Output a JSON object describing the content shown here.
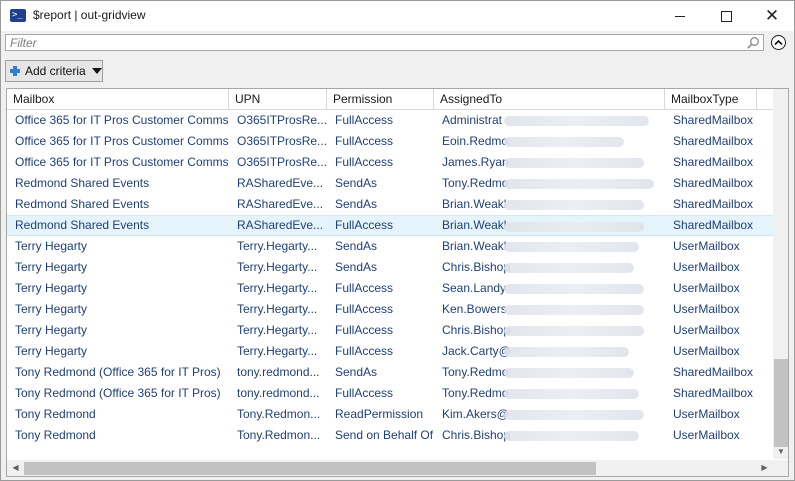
{
  "window": {
    "title": "$report | out-gridview",
    "app_icon": "powershell-icon",
    "controls": [
      "minimize-icon",
      "maximize-icon",
      "close-icon"
    ]
  },
  "filter": {
    "placeholder": "Filter",
    "value": "",
    "search_icon": "search-icon",
    "collapse_icon": "chevron-up-circle-icon"
  },
  "add_criteria": {
    "label": "Add criteria",
    "icon": "plus-icon",
    "dropdown_icon": "dropdown-arrow-icon"
  },
  "grid": {
    "columns": [
      "Mailbox",
      "UPN",
      "Permission",
      "AssignedTo",
      "MailboxType"
    ],
    "selected_row_index": 5,
    "rows": [
      {
        "mailbox": "Office 365 for IT Pros Customer Comms",
        "upn": "O365ITProsRe...",
        "permission": "FullAccess",
        "assigned_to": "Administrat",
        "type": "SharedMailbox"
      },
      {
        "mailbox": "Office 365 for IT Pros Customer Comms",
        "upn": "O365ITProsRe...",
        "permission": "FullAccess",
        "assigned_to": "Eoin.Redmo",
        "type": "SharedMailbox"
      },
      {
        "mailbox": "Office 365 for IT Pros Customer Comms",
        "upn": "O365ITProsRe...",
        "permission": "FullAccess",
        "assigned_to": "James.Ryan",
        "type": "SharedMailbox"
      },
      {
        "mailbox": "Redmond Shared Events",
        "upn": "RASharedEve...",
        "permission": "SendAs",
        "assigned_to": "Tony.Redmo",
        "type": "SharedMailbox"
      },
      {
        "mailbox": "Redmond Shared Events",
        "upn": "RASharedEve...",
        "permission": "SendAs",
        "assigned_to": "Brian.Weakl",
        "type": "SharedMailbox"
      },
      {
        "mailbox": "Redmond Shared Events",
        "upn": "RASharedEve...",
        "permission": "FullAccess",
        "assigned_to": "Brian.Weakl",
        "type": "SharedMailbox"
      },
      {
        "mailbox": "Terry Hegarty",
        "upn": "Terry.Hegarty...",
        "permission": "SendAs",
        "assigned_to": "Brian.Weakl",
        "type": "UserMailbox"
      },
      {
        "mailbox": "Terry Hegarty",
        "upn": "Terry.Hegarty...",
        "permission": "SendAs",
        "assigned_to": "Chris.Bishop",
        "type": "UserMailbox"
      },
      {
        "mailbox": "Terry Hegarty",
        "upn": "Terry.Hegarty...",
        "permission": "FullAccess",
        "assigned_to": "Sean.Landy",
        "type": "UserMailbox"
      },
      {
        "mailbox": "Terry Hegarty",
        "upn": "Terry.Hegarty...",
        "permission": "FullAccess",
        "assigned_to": "Ken.Bowers",
        "type": "UserMailbox"
      },
      {
        "mailbox": "Terry Hegarty",
        "upn": "Terry.Hegarty...",
        "permission": "FullAccess",
        "assigned_to": "Chris.Bishop",
        "type": "UserMailbox"
      },
      {
        "mailbox": "Terry Hegarty",
        "upn": "Terry.Hegarty...",
        "permission": "FullAccess",
        "assigned_to": "Jack.Carty@",
        "type": "UserMailbox"
      },
      {
        "mailbox": "Tony Redmond (Office 365 for IT Pros)",
        "upn": "tony.redmond...",
        "permission": "SendAs",
        "assigned_to": "Tony.Redmo",
        "type": "SharedMailbox"
      },
      {
        "mailbox": "Tony Redmond (Office 365 for IT Pros)",
        "upn": "tony.redmond...",
        "permission": "FullAccess",
        "assigned_to": "Tony.Redmo",
        "type": "SharedMailbox"
      },
      {
        "mailbox": "Tony Redmond",
        "upn": "Tony.Redmon...",
        "permission": "ReadPermission",
        "assigned_to": "Kim.Akers@",
        "type": "UserMailbox"
      },
      {
        "mailbox": "Tony Redmond",
        "upn": "Tony.Redmon...",
        "permission": "Send on Behalf Of",
        "assigned_to": "Chris.Bishop",
        "type": "UserMailbox"
      }
    ]
  },
  "colors": {
    "selected_row": "#e5f3fb",
    "cell_text": "#1f3f7a",
    "accent_plus": "#2f7fd6",
    "title_icon": "#1f3f8f"
  }
}
